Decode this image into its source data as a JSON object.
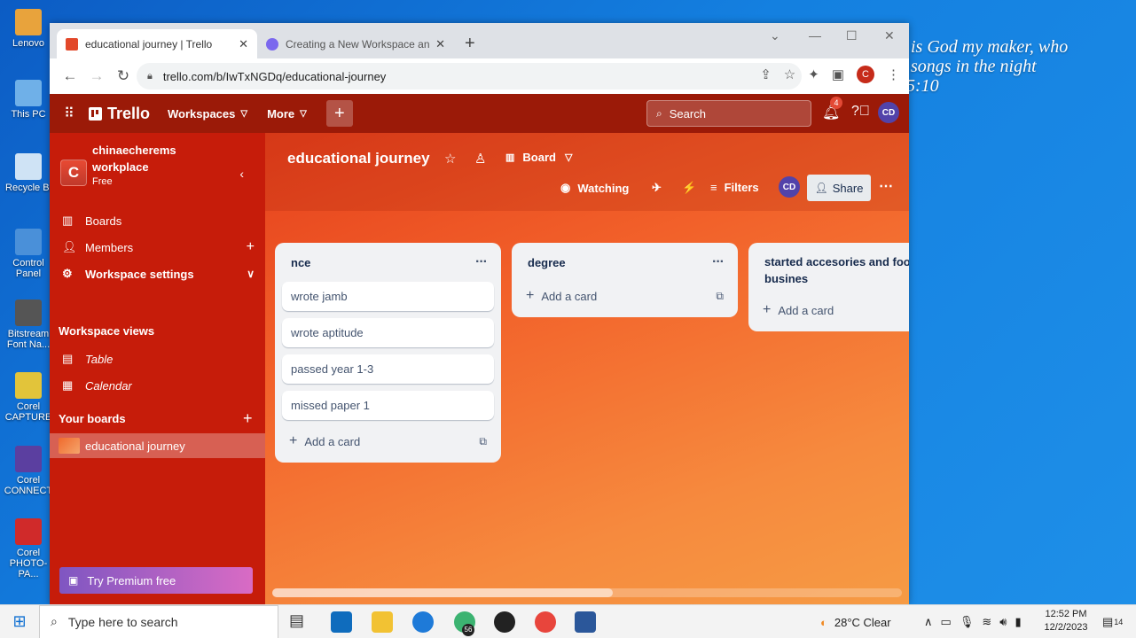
{
  "desktop": {
    "icons": [
      "Lenovo",
      "This PC",
      "Recycle Bi",
      "Control Panel",
      "Bitstream Font Na...",
      "Corel CAPTURE",
      "Corel CONNECT",
      "Corel PHOTO-PA..."
    ],
    "verse": " is God my maker, who\n songs in the night\n5:10"
  },
  "browser": {
    "tabs": [
      {
        "title": "educational journey | Trello",
        "favicon_color": "#e2482a"
      },
      {
        "title": "Creating a New Workspace and",
        "favicon_color": "#7b68ee"
      }
    ],
    "url": "trello.com/b/IwTxNGDq/educational-journey",
    "profile_initial": "C"
  },
  "trello": {
    "logo": "Trello",
    "menus": [
      "Workspaces",
      "More"
    ],
    "search_placeholder": "Search",
    "notification_count": "4",
    "avatar": "CD"
  },
  "sidebar": {
    "workspace_initial": "C",
    "workspace_name": "chinaecherems workplace",
    "plan": "Free",
    "items": [
      "Boards",
      "Members",
      "Workspace settings"
    ],
    "views_heading": "Workspace views",
    "views": [
      "Table",
      "Calendar"
    ],
    "boards_heading": "Your boards",
    "boards": [
      "educational journey"
    ],
    "premium": "Try Premium free"
  },
  "board": {
    "title": "educational journey",
    "view": "Board",
    "watching": "Watching",
    "filters": "Filters",
    "share": "Share",
    "lists": [
      {
        "title": "nce",
        "cards": [
          "wrote jamb",
          "wrote aptitude",
          "passed year 1-3",
          "missed paper 1"
        ],
        "add": "Add a card"
      },
      {
        "title": "degree",
        "cards": [],
        "add": "Add a card"
      },
      {
        "title": "started accesories and food stuff busines",
        "cards": [],
        "add": "Add a card"
      }
    ]
  },
  "taskbar": {
    "search_placeholder": "Type here to search",
    "weather": "28°C  Clear",
    "time": "12:52 PM",
    "date": "12/2/2023",
    "notifications": "14",
    "badge": "56"
  }
}
